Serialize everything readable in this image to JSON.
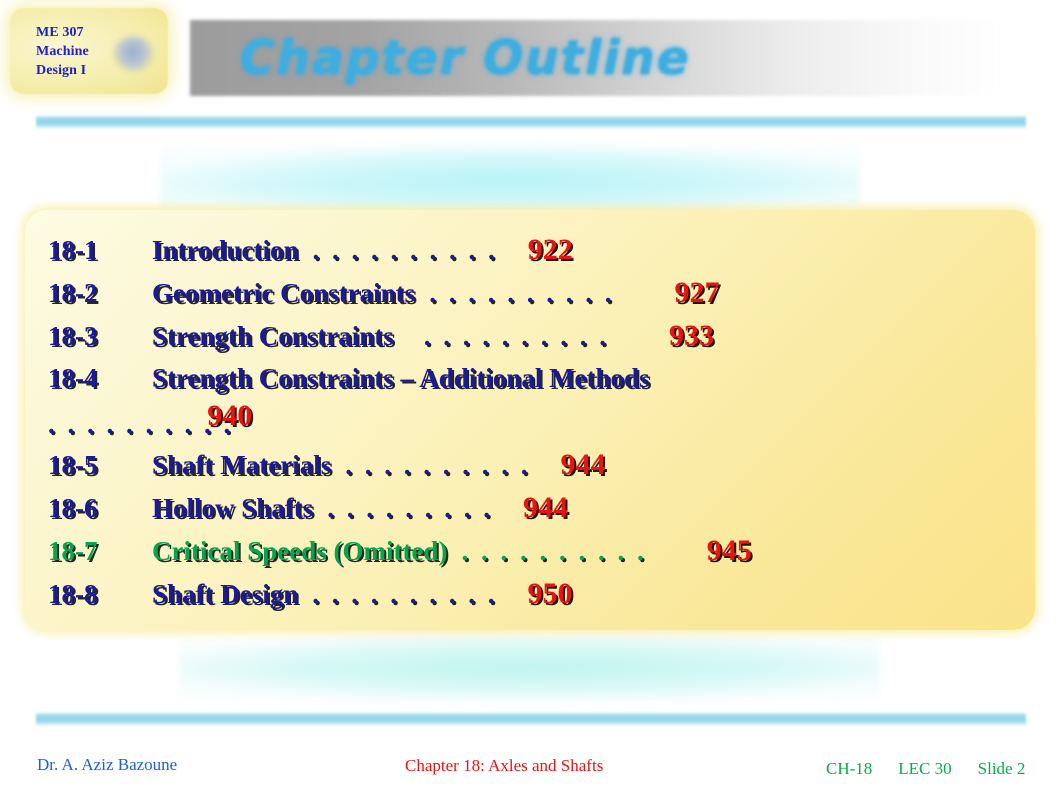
{
  "slide": {
    "badge": {
      "line1": "ME 307",
      "line2": "Machine",
      "line3": "Design I",
      "logo_icon": "university-seal-icon"
    },
    "title": "Chapter Outline",
    "accent_color": "#8ed3e8",
    "panel_color": "#faec9f"
  },
  "outline": {
    "items": [
      {
        "number": "18-1",
        "title": "Introduction",
        "dots": ". . . . . . . . . .",
        "page": "922",
        "color": "#1a1a9c",
        "wraps": false
      },
      {
        "number": "18-2",
        "title": "Geometric Constraints",
        "dots": ". . . . . . . . . .",
        "page": "927",
        "color": "#1a1a9c",
        "wraps": false
      },
      {
        "number": "18-3",
        "title": "Strength Constraints",
        "dots": ". . . . . . . . . .",
        "page": "933",
        "color": "#1a1a9c",
        "wraps": false
      },
      {
        "number": "18-4",
        "title": "Strength Constraints – Additional Methods",
        "dots": ". . . . . . . . . .",
        "page": "940",
        "color": "#1a1a9c",
        "wraps": true
      },
      {
        "number": "18-5",
        "title": "Shaft  Materials",
        "dots": ". . . . . . . . . .",
        "page": "944",
        "color": "#1a1a9c",
        "wraps": false
      },
      {
        "number": "18-6",
        "title": "Hollow Shafts",
        "dots": ". . . . . . . . .",
        "page": "944",
        "color": "#1a1a9c",
        "wraps": false
      },
      {
        "number": "18-7",
        "title": "Critical Speeds (Omitted)",
        "dots": ". . . . . . . . . .",
        "page": "945",
        "color": "#00a650",
        "wraps": false
      },
      {
        "number": "18-8",
        "title": "Shaft Design",
        "dots": ". . . . . . . . . .",
        "page": "950",
        "color": "#1a1a9c",
        "wraps": false
      }
    ]
  },
  "footer": {
    "author": "Dr. A. Aziz Bazoune",
    "center": "Chapter 18: Axles and Shafts",
    "chapter_tag": "CH-18",
    "lecture_tag": "LEC 30",
    "slide_tag": "Slide 2"
  }
}
